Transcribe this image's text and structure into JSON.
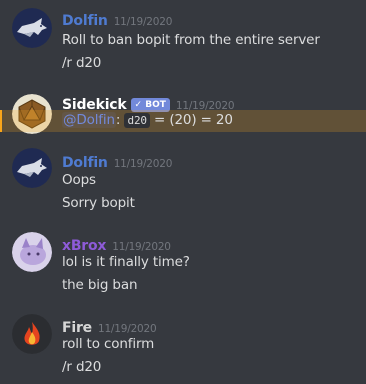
{
  "messages": [
    {
      "author": "Dolfin",
      "author_color": "#4f7bd1",
      "timestamp": "11/19/2020",
      "lines": [
        "Roll to ban bopit from the entire server",
        "/r d20"
      ]
    },
    {
      "author": "Sidekick",
      "author_color": "#ffffff",
      "badge": "✓ BOT",
      "timestamp": "11/19/2020",
      "mention": "@Dolfin",
      "after_mention": ": ",
      "code": "d20",
      "result": " = (20) = 20"
    },
    {
      "author": "Dolfin",
      "author_color": "#4f7bd1",
      "timestamp": "11/19/2020",
      "lines": [
        "Oops",
        "Sorry bopit"
      ]
    },
    {
      "author": "xBrox",
      "author_color": "#8e5bd8",
      "timestamp": "11/19/2020",
      "lines": [
        "lol is it finally time?",
        "the big ban"
      ]
    },
    {
      "author": "Fire",
      "author_color": "#d6d6d6",
      "timestamp": "11/19/2020",
      "lines": [
        "roll to confirm",
        "/r d20"
      ]
    }
  ]
}
